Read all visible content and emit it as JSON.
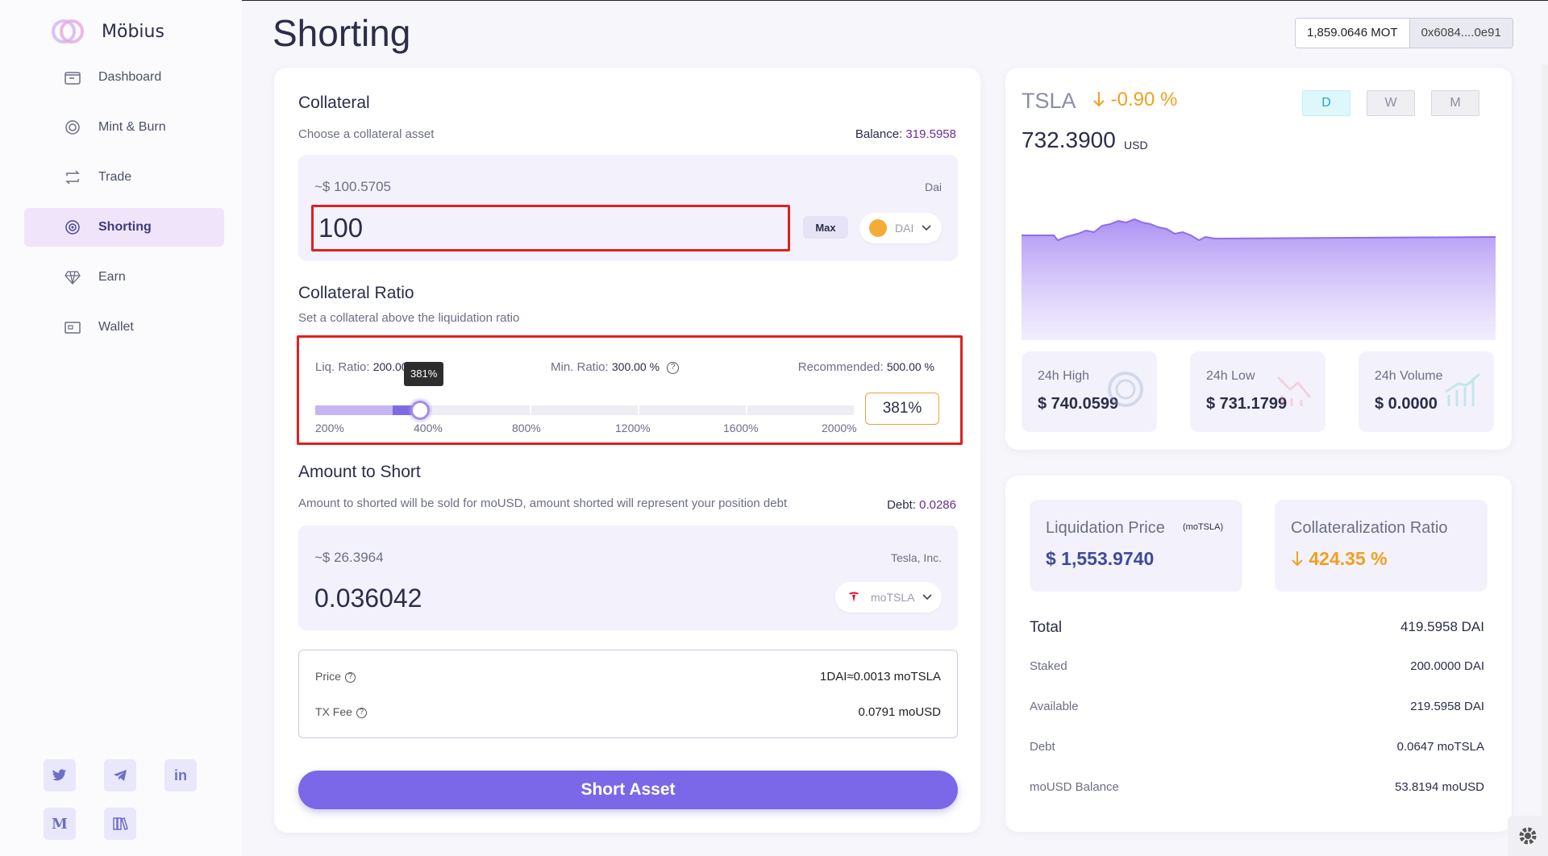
{
  "brand": {
    "name": "Möbius"
  },
  "nav": [
    {
      "label": "Dashboard",
      "icon": "dashboard-icon",
      "active": false
    },
    {
      "label": "Mint & Burn",
      "icon": "mint-icon",
      "active": false
    },
    {
      "label": "Trade",
      "icon": "trade-icon",
      "active": false
    },
    {
      "label": "Shorting",
      "icon": "target-icon",
      "active": true
    },
    {
      "label": "Earn",
      "icon": "diamond-icon",
      "active": false
    },
    {
      "label": "Wallet",
      "icon": "wallet-icon",
      "active": false
    }
  ],
  "social": {
    "linkedin": "in",
    "medium": "M"
  },
  "header": {
    "title": "Shorting",
    "mot_balance": "1,859.0646 MOT",
    "address": "0x6084....0e91"
  },
  "collateral": {
    "title": "Collateral",
    "subtitle": "Choose a collateral asset",
    "balance_label": "Balance:",
    "balance_value": "319.5958",
    "approx": "~$ 100.5705",
    "asset_name": "Dai",
    "amount": "100",
    "max_label": "Max",
    "token": "DAI"
  },
  "ratio": {
    "title": "Collateral Ratio",
    "subtitle": "Set a collateral above the liquidation ratio",
    "liq_label": "Liq. Ratio:",
    "liq_value": "200.00 %",
    "min_label": "Min. Ratio:",
    "min_value": "300.00 %",
    "rec_label": "Recommended:",
    "rec_value": "500.00 %",
    "current": "381%",
    "ticks": [
      "200%",
      "400%",
      "800%",
      "1200%",
      "1600%",
      "2000%"
    ]
  },
  "short": {
    "title": "Amount to Short",
    "subtitle": "Amount to shorted will be sold for moUSD, amount shorted will represent your position debt",
    "debt_label": "Debt:",
    "debt_value": "0.0286",
    "approx": "~$ 26.3964",
    "asset_name": "Tesla, Inc.",
    "amount": "0.036042",
    "token": "moTSLA"
  },
  "info": {
    "price_label": "Price",
    "price_value": "1DAI≈0.0013 moTSLA",
    "fee_label": "TX Fee",
    "fee_value": "0.0791 moUSD"
  },
  "action": {
    "label": "Short Asset"
  },
  "market": {
    "ticker": "TSLA",
    "change": "-0.90 %",
    "price": "732.3900",
    "unit": "USD",
    "periods": [
      "D",
      "W",
      "M"
    ],
    "stats": [
      {
        "label": "24h High",
        "value": "$ 740.0599",
        "icon": "coin-icon"
      },
      {
        "label": "24h Low",
        "value": "$ 731.1799",
        "icon": "trend-down-icon"
      },
      {
        "label": "24h Volume",
        "value": "$ 0.0000",
        "icon": "bar-chart-icon"
      }
    ],
    "chart_color": "#a98cf3"
  },
  "position": {
    "liq_title": "Liquidation Price",
    "liq_unit": "(moTSLA)",
    "liq_value": "$ 1,553.9740",
    "coll_title": "Collateralization Ratio",
    "coll_value": "424.35 %",
    "rows": [
      {
        "label": "Total",
        "value": "419.5958 DAI"
      },
      {
        "label": "Staked",
        "value": "200.0000 DAI"
      },
      {
        "label": "Available",
        "value": "219.5958 DAI"
      },
      {
        "label": "Debt",
        "value": "0.0647 moTSLA"
      },
      {
        "label": "moUSD Balance",
        "value": "53.8194 moUSD"
      }
    ]
  }
}
